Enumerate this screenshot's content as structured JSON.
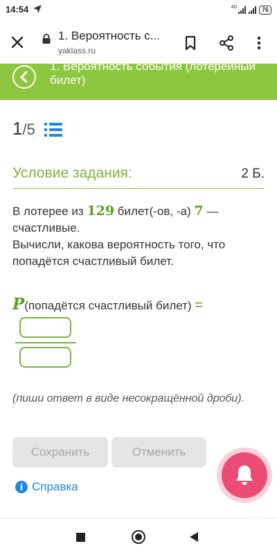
{
  "status_bar": {
    "time": "14:54",
    "network_label": "4G",
    "battery": "76",
    "icons": [
      "navigation-icon",
      "signal-icon",
      "battery-icon"
    ]
  },
  "browser": {
    "page_title": "1. Вероятность с...",
    "url": "yaklass.ru",
    "icons": [
      "close-icon",
      "lock-icon",
      "bookmark-icon",
      "share-icon",
      "more-vert-icon"
    ]
  },
  "header": {
    "title": "1. Вероятность события (лотерейный билет)",
    "background": "#8dc63f",
    "back_icon": "chevron-left-icon"
  },
  "pagination": {
    "current": "1",
    "separator": "/",
    "total": "5",
    "list_icon": "list-icon"
  },
  "task": {
    "title": "Условие задания:",
    "points": "2 Б.",
    "text_part1": "В лотерее из ",
    "total_tickets": "129",
    "text_part2": " билет(-ов, -а) ",
    "lucky_tickets": "7",
    "text_part3": " — счастливые.",
    "question": "Вычисли, какова вероятность того, что попадётся счастливый билет.",
    "formula_p": "P",
    "formula_event": "(попадётся счастливый билет)",
    "formula_eq": "=",
    "hint": "(пиши ответ в виде несокращённой дроби).",
    "numerator_value": "",
    "denominator_value": ""
  },
  "buttons": {
    "save": "Сохранить",
    "cancel": "Отменить"
  },
  "help": {
    "icon_text": "i",
    "label": "Справка"
  },
  "colors": {
    "accent_green": "#8dc63f",
    "number_green": "#5a9e1f",
    "link_blue": "#1e88e5",
    "fab_pink": "#ec4b75",
    "button_gray": "#e5e5e5"
  },
  "fab_icon": "bell-icon"
}
